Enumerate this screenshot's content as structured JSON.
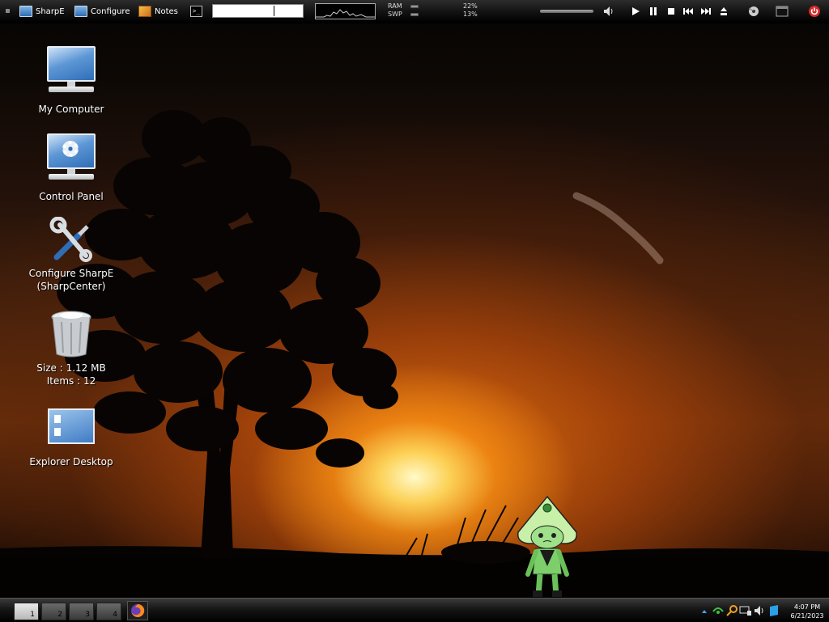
{
  "topbar": {
    "sharpe_label": "SharpE",
    "configure_label": "Configure",
    "notes_label": "Notes",
    "terminal_glyph": ">_",
    "ram_label": "RAM",
    "ram_percent": "22%",
    "swp_label": "SWP",
    "swp_percent": "13%"
  },
  "desktop_icons": [
    {
      "label": "My Computer"
    },
    {
      "label": "Control Panel"
    },
    {
      "label_line1": "Configure SharpE",
      "label_line2": "(SharpCenter)"
    },
    {
      "label_line1": "Size : 1.12 MB",
      "label_line2": "Items : 12"
    },
    {
      "label": "Explorer Desktop"
    }
  ],
  "taskbar": {
    "workspaces": [
      "1",
      "2",
      "3",
      "4"
    ],
    "active_workspace": "1",
    "time": "4:07 PM",
    "date": "6/21/2023"
  },
  "colors": {
    "bar_bg": "#111111",
    "accent_blue": "#2f6db6",
    "power_red": "#d42a2a"
  }
}
